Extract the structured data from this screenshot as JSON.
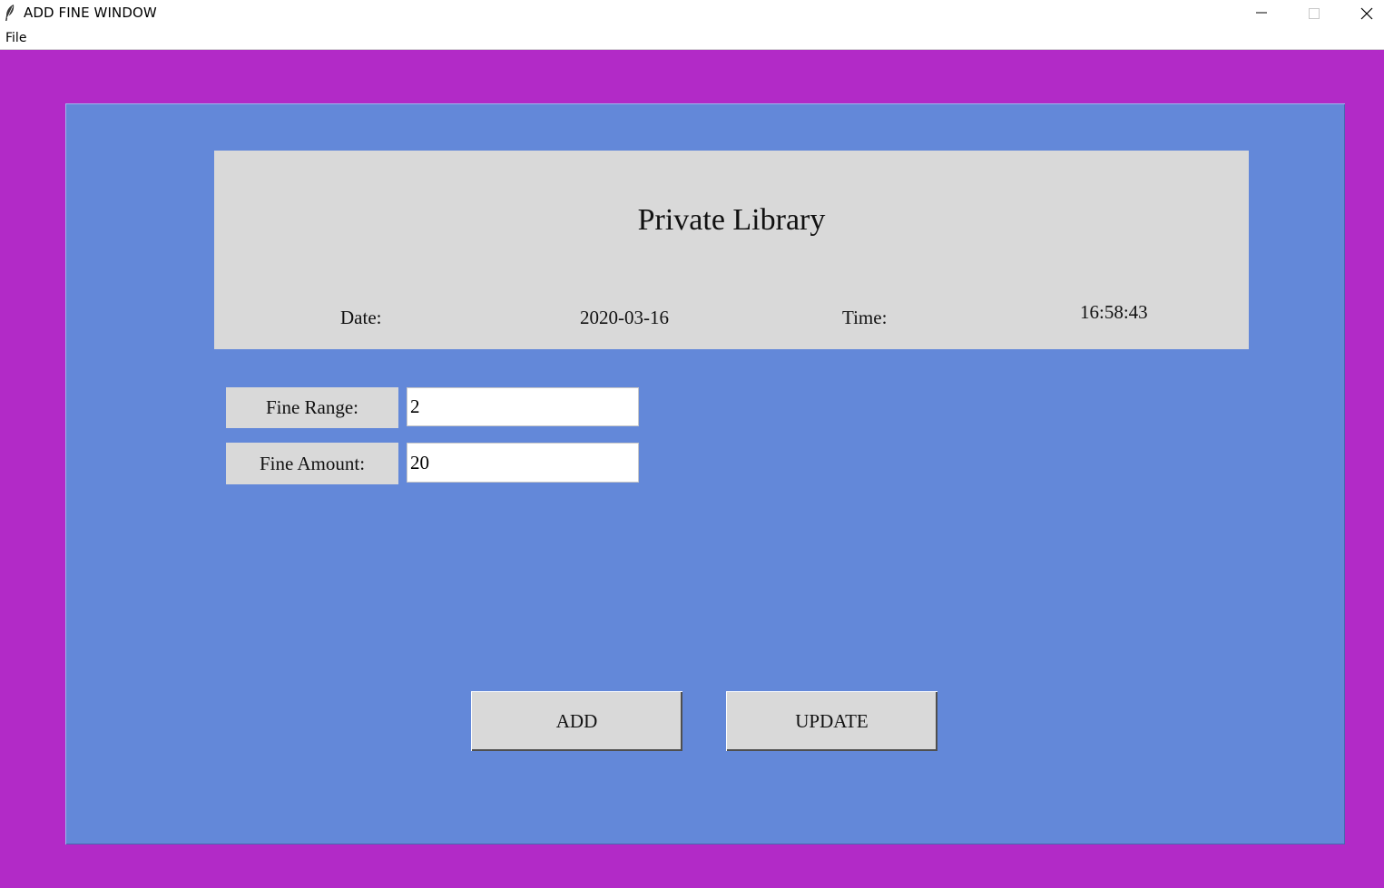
{
  "window": {
    "title": "ADD FINE WINDOW",
    "app_icon": "feather-icon",
    "controls": [
      "minimize-icon",
      "maximize-icon",
      "close-icon"
    ]
  },
  "menubar": {
    "items": [
      {
        "label": "File"
      }
    ]
  },
  "colors": {
    "outer_background": "#b22ac7",
    "inner_background": "#6388d9",
    "panel_background": "#d9d9d9"
  },
  "header": {
    "title": "Private Library",
    "date_label": "Date:",
    "date_value": "2020-03-16",
    "time_label": "Time:",
    "time_value": "16:58:43"
  },
  "form": {
    "fine_range": {
      "label": "Fine Range:",
      "value": "2"
    },
    "fine_amount": {
      "label": "Fine Amount:",
      "value": "20"
    }
  },
  "buttons": {
    "add": "ADD",
    "update": "UPDATE"
  }
}
